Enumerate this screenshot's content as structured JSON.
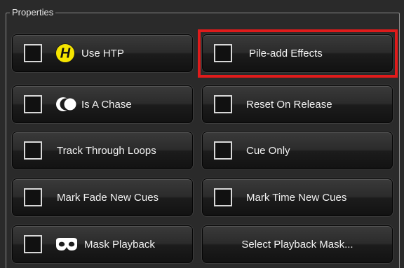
{
  "group": {
    "title": "Properties"
  },
  "buttons": {
    "use_htp": {
      "label": "Use HTP",
      "icon": "htp-icon"
    },
    "pile_add_effects": {
      "label": "Pile-add Effects"
    },
    "is_a_chase": {
      "label": "Is A Chase",
      "icon": "chase-icon"
    },
    "reset_on_release": {
      "label": "Reset On Release"
    },
    "track_through_loops": {
      "label": "Track Through Loops"
    },
    "cue_only": {
      "label": "Cue Only"
    },
    "mark_fade_new_cues": {
      "label": "Mark Fade New Cues"
    },
    "mark_time_new_cues": {
      "label": "Mark Time New Cues"
    },
    "mask_playback": {
      "label": "Mask Playback",
      "icon": "mask-icon"
    },
    "select_playback_mask": {
      "label": "Select Playback Mask..."
    }
  },
  "colors": {
    "highlight": "#e01b1b",
    "htp_icon": "#f5e400"
  }
}
